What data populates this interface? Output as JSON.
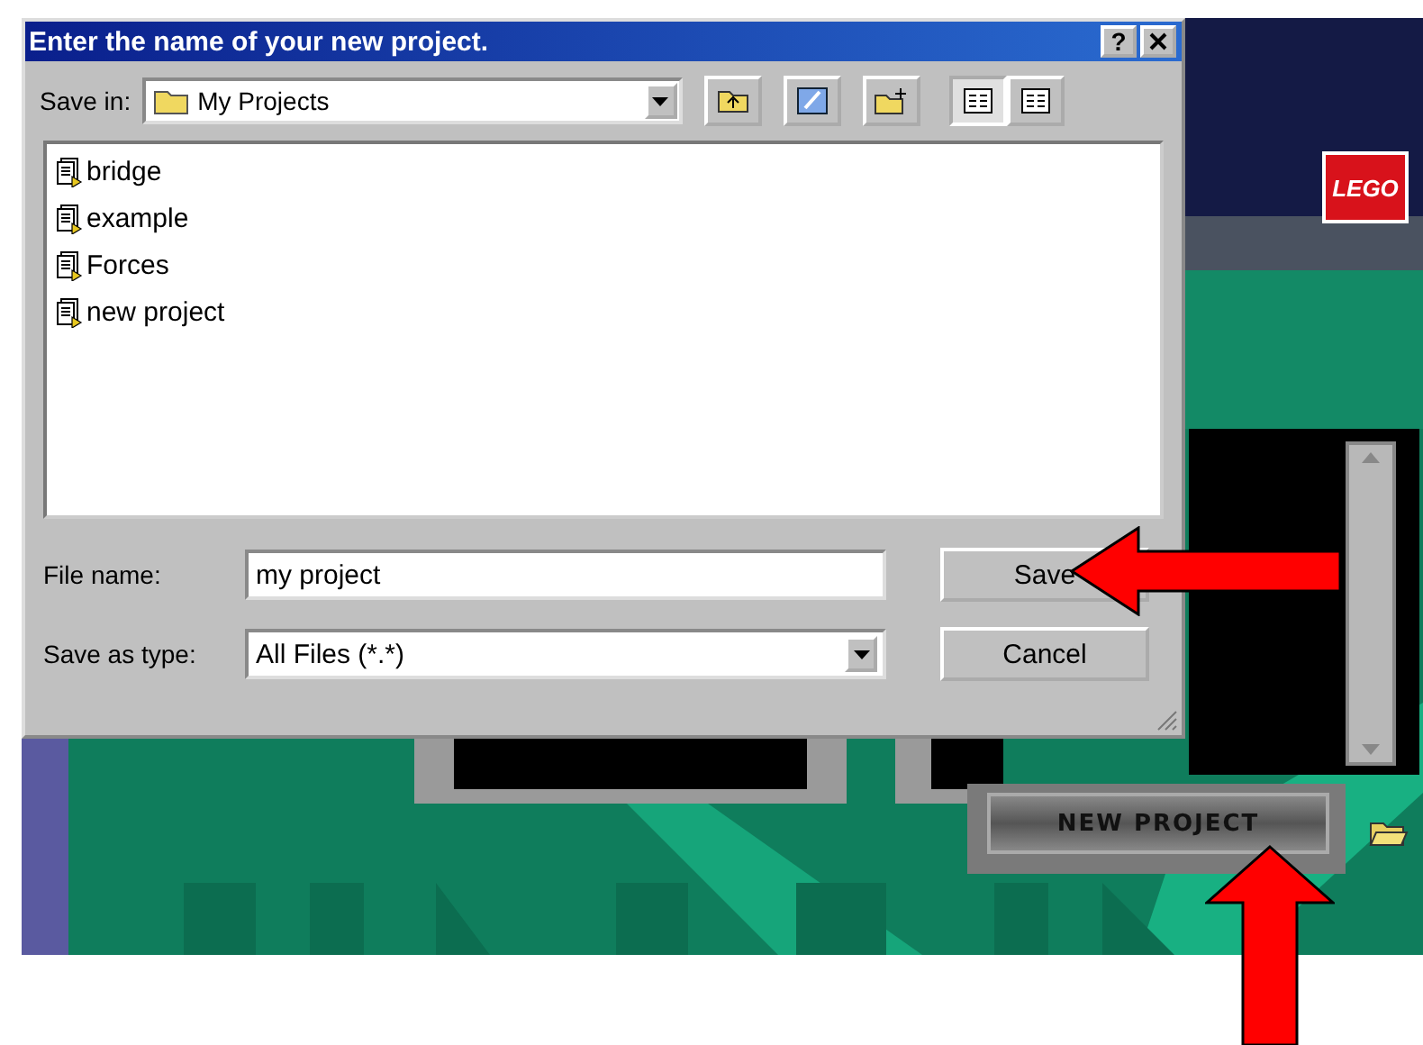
{
  "app": {
    "logo": "LEGO",
    "new_project_button": "NEW PROJECT"
  },
  "dialog": {
    "title": "Enter the name of your new project.",
    "help_button": "?",
    "save_in": {
      "label": "Save in:",
      "value": "My Projects"
    },
    "view_buttons": [
      {
        "selected": true
      },
      {
        "selected": false
      }
    ],
    "files": [
      {
        "name": "bridge"
      },
      {
        "name": "example"
      },
      {
        "name": "Forces"
      },
      {
        "name": "new project"
      }
    ],
    "file_name": {
      "label": "File name:",
      "value": "my project"
    },
    "save_as_type": {
      "label": "Save as type:",
      "value": "All Files (*.*)"
    },
    "buttons": [
      "Save",
      "Cancel"
    ]
  }
}
